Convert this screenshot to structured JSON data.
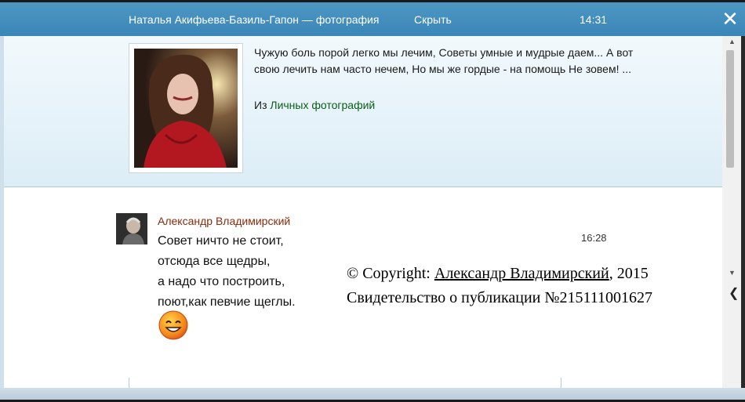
{
  "header": {
    "title": "Наталья Акифьева-Базиль-Гапон — фотография",
    "hide_label": "Скрыть",
    "time": "14:31",
    "close_icon": "close-icon"
  },
  "photo_post": {
    "caption": "Чужую боль порой легко мы лечим, Советы умные и мудрые даем... А вот свою лечить нам часто нечем, Но мы же гордые - на помощь Не зовем! ...",
    "from_prefix": "Из",
    "from_link": "Личных фотографий"
  },
  "comment": {
    "author": "Александр Владимирский",
    "time": "16:28",
    "lines": [
      "Совет ничто не стоит,",
      "отсюда все щедры,",
      "а надо что построить,",
      "поют,как певчие щеглы."
    ],
    "emoji_icon": "smiley-icon"
  },
  "copyright": {
    "prefix": "© Copyright:",
    "author_link": "Александр Владимирский",
    "year": ", 2015",
    "certificate": "Свидетельство о публикации №215111001627"
  },
  "colors": {
    "topbar": "#3a86b8",
    "author": "#8b2a0a",
    "link": "#0b5e16"
  }
}
